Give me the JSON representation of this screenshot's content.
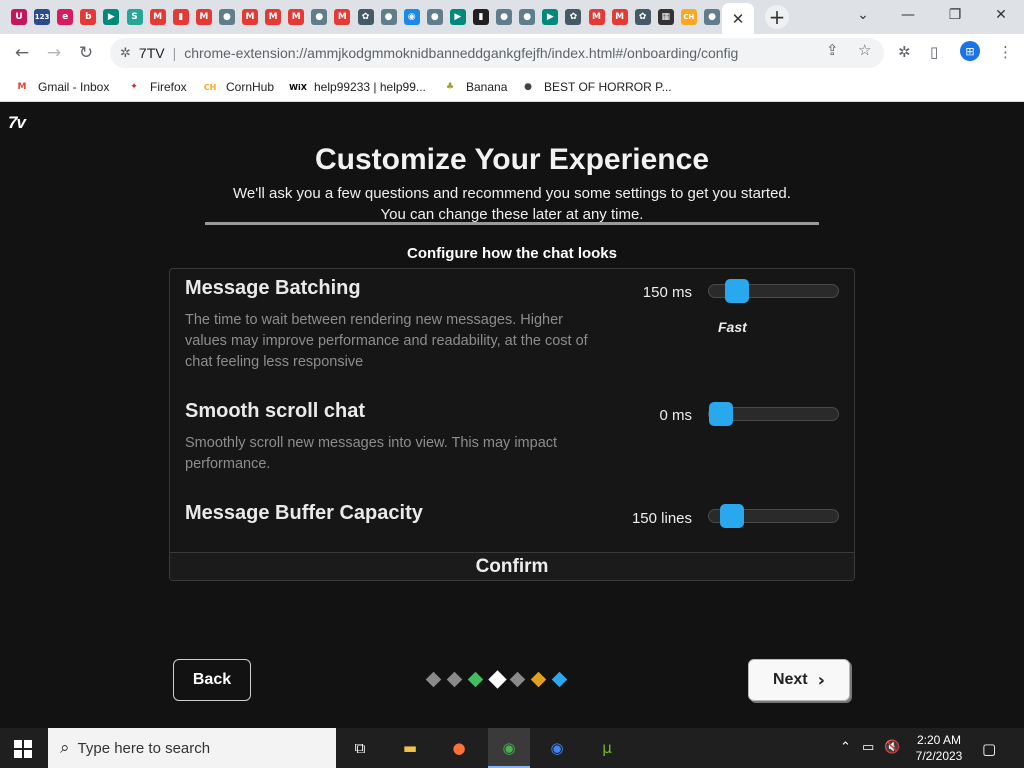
{
  "browser": {
    "tabs": [
      {
        "icon": "U",
        "color": "#c2185b"
      },
      {
        "icon": "123",
        "color": "#2b4b8c"
      },
      {
        "icon": "e",
        "color": "#d81b60"
      },
      {
        "icon": "b",
        "color": "#e53935"
      },
      {
        "icon": "▶",
        "color": "#00897b"
      },
      {
        "icon": "S",
        "color": "#26a69a"
      },
      {
        "icon": "M",
        "color": "#e53935"
      },
      {
        "icon": "▮",
        "color": "#e53935"
      },
      {
        "icon": "M",
        "color": "#e53935"
      },
      {
        "icon": "●",
        "color": "#607d8b"
      },
      {
        "icon": "M",
        "color": "#e53935"
      },
      {
        "icon": "M",
        "color": "#e53935"
      },
      {
        "icon": "M",
        "color": "#e53935"
      },
      {
        "icon": "●",
        "color": "#607d8b"
      },
      {
        "icon": "M",
        "color": "#e53935"
      },
      {
        "icon": "✿",
        "color": "#455a64"
      },
      {
        "icon": "●",
        "color": "#607d8b"
      },
      {
        "icon": "◉",
        "color": "#1e88e5"
      },
      {
        "icon": "●",
        "color": "#607d8b"
      },
      {
        "icon": "▶",
        "color": "#00897b"
      },
      {
        "icon": "▮",
        "color": "#212121"
      },
      {
        "icon": "●",
        "color": "#607d8b"
      },
      {
        "icon": "●",
        "color": "#607d8b"
      },
      {
        "icon": "▶",
        "color": "#00897b"
      },
      {
        "icon": "✿",
        "color": "#455a64"
      },
      {
        "icon": "M",
        "color": "#e53935"
      },
      {
        "icon": "M",
        "color": "#e53935"
      },
      {
        "icon": "✿",
        "color": "#455a64"
      },
      {
        "icon": "▦",
        "color": "#333333"
      },
      {
        "icon": "CH",
        "color": "#f9a825"
      },
      {
        "icon": "●",
        "color": "#607d8b"
      }
    ],
    "active_tab_close": "✕",
    "new_tab": "+",
    "window_controls": {
      "dropdown": "⌄",
      "minimize": "—",
      "restore": "❐",
      "close": "✕"
    },
    "site_name": "7TV",
    "url": "chrome-extension://ammjkodgmmoknidbanneddgankgfejfh/index.html#/onboarding/config",
    "bookmarks": [
      {
        "label": "Gmail - Inbox",
        "icon": "M",
        "color": "#ea4335"
      },
      {
        "label": "Firefox",
        "icon": "✦",
        "color": "#c62828"
      },
      {
        "label": "CornHub",
        "icon": "CH",
        "color": "#f9a825"
      },
      {
        "label": "help99233 | help99...",
        "icon": "WiX",
        "color": "#000000"
      },
      {
        "label": "Banana",
        "icon": "♣",
        "color": "#9e9d24"
      },
      {
        "label": "BEST OF HORROR P...",
        "icon": "●",
        "color": "#424242"
      }
    ]
  },
  "page": {
    "logo": "7v",
    "title": "Customize Your Experience",
    "subtitle_line1": "We'll ask you a few questions and recommend you some settings to get you started.",
    "subtitle_line2": "You can change these later at any time.",
    "section_label": "Configure how the chat looks",
    "settings": [
      {
        "name": "Message Batching",
        "description": "The time to wait between rendering new messages. Higher values may improve performance and readability, at the cost of chat feeling less responsive",
        "value": "150 ms",
        "hint": "Fast",
        "slider_fraction": 0.15
      },
      {
        "name": "Smooth scroll chat",
        "description": "Smoothly scroll new messages into view. This may impact performance.",
        "value": "0 ms",
        "slider_fraction": 0.0
      },
      {
        "name": "Message Buffer Capacity",
        "value": "150 lines",
        "slider_fraction": 0.1
      }
    ],
    "confirm_label": "Confirm",
    "back_label": "Back",
    "next_label": "Next",
    "steps": [
      {
        "color": "#8a8a8a"
      },
      {
        "color": "#8a8a8a"
      },
      {
        "color": "#3fbf5f"
      },
      {
        "color": "#ffffff"
      },
      {
        "color": "#8a8a8a"
      },
      {
        "color": "#e0a020"
      },
      {
        "color": "#2aa8ee"
      }
    ],
    "slider_color": "#2aa8ee"
  },
  "taskbar": {
    "search_placeholder": "Type here to search",
    "time": "2:20 AM",
    "date": "7/2/2023"
  }
}
